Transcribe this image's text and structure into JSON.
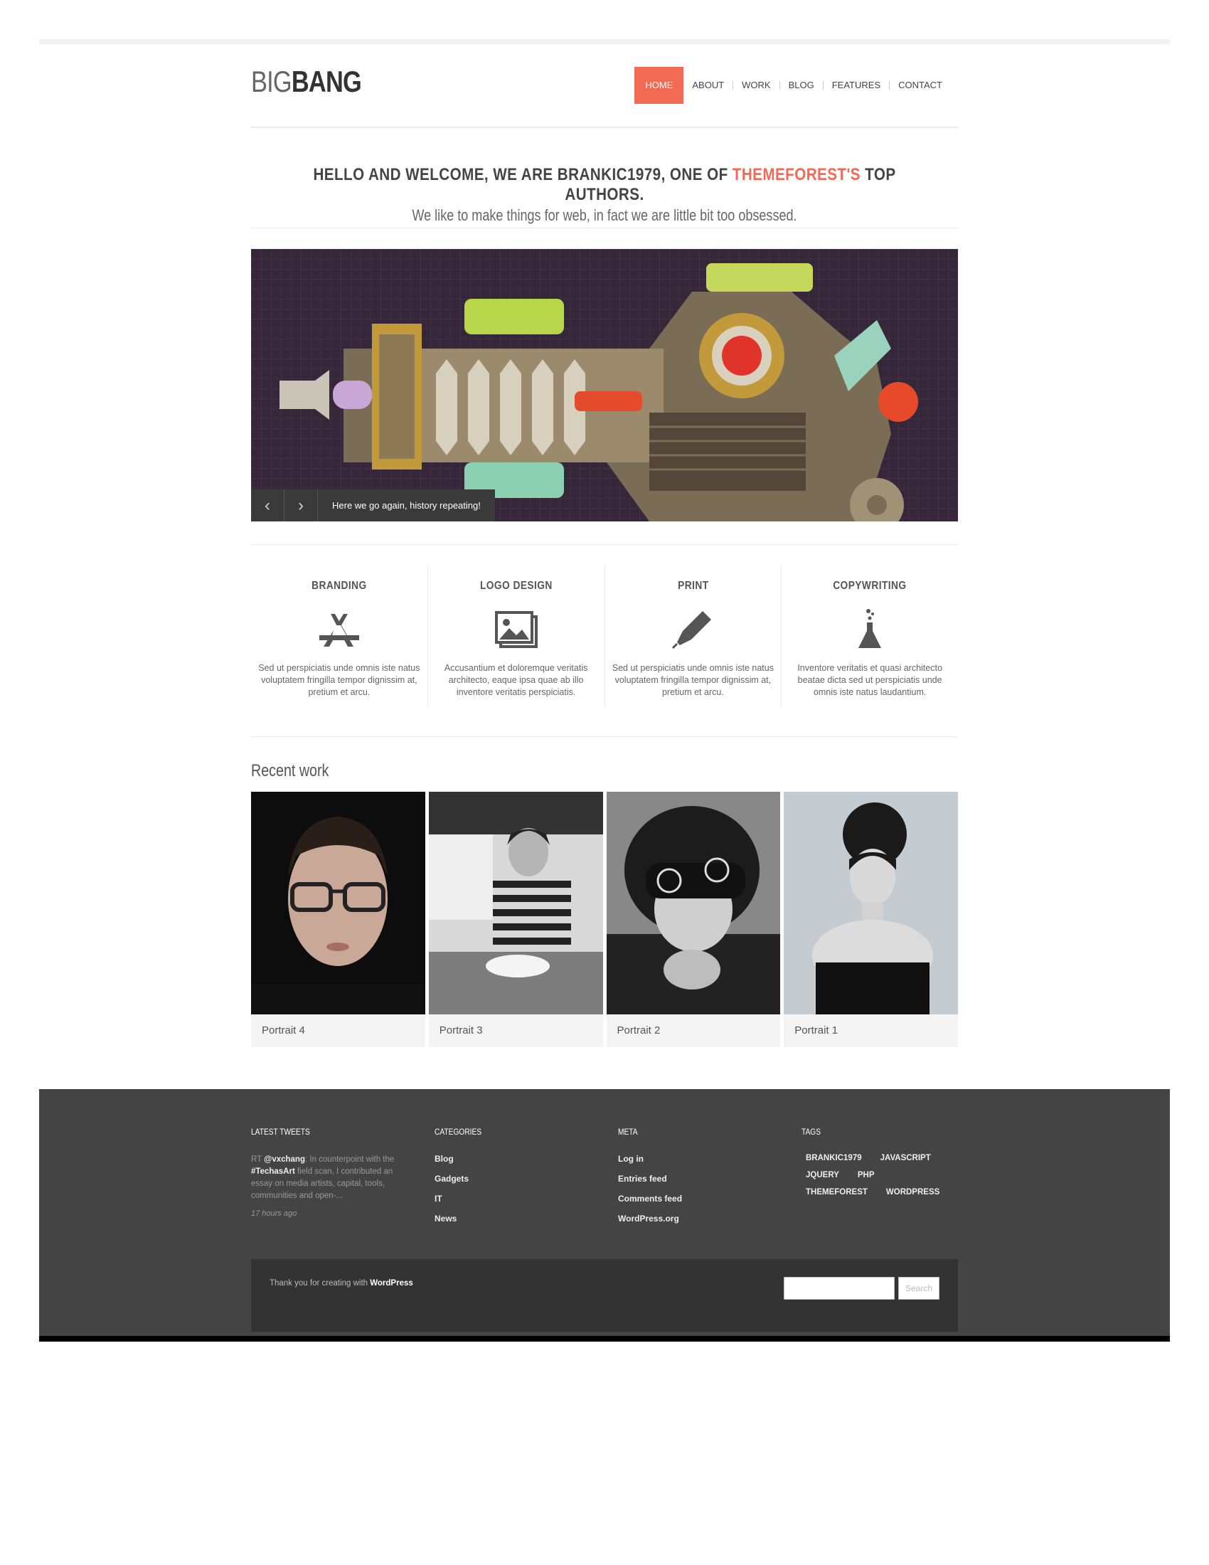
{
  "logo": {
    "thin": "BIG",
    "bold": "BANG"
  },
  "nav": [
    {
      "label": "HOME",
      "active": true
    },
    {
      "label": "ABOUT",
      "active": false
    },
    {
      "label": "WORK",
      "active": false
    },
    {
      "label": "BLOG",
      "active": false
    },
    {
      "label": "FEATURES",
      "active": false
    },
    {
      "label": "CONTACT",
      "active": false
    }
  ],
  "welcome": {
    "title_before": "HELLO AND WELCOME, WE ARE BRANKIC1979, ONE OF ",
    "title_accent": "THEMEFOREST'S",
    "title_after": " TOP AUTHORS.",
    "subtitle": "We like to make things for web, in fact we are little bit too obsessed."
  },
  "slider": {
    "prev_icon": "chevron-left-icon",
    "next_icon": "chevron-right-icon",
    "caption": "Here we go again, history repeating!"
  },
  "services": [
    {
      "title": "BRANDING",
      "icon": "app-store-icon",
      "text": "Sed ut perspiciatis unde omnis iste natus voluptatem fringilla tempor dignissim at, pretium et arcu."
    },
    {
      "title": "LOGO DESIGN",
      "icon": "image-icon",
      "text": "Accusantium et doloremque veritatis architecto, eaque ipsa quae ab illo inventore veritatis perspiciatis."
    },
    {
      "title": "PRINT",
      "icon": "pen-icon",
      "text": "Sed ut perspiciatis unde omnis iste natus voluptatem fringilla tempor dignissim at, pretium et arcu."
    },
    {
      "title": "COPYWRITING",
      "icon": "flask-icon",
      "text": "Inventore veritatis et quasi architecto beatae dicta sed ut perspiciatis unde omnis iste natus laudantium."
    }
  ],
  "recent_work": {
    "title": "Recent work",
    "items": [
      {
        "label": "Portrait 4"
      },
      {
        "label": "Portrait 3"
      },
      {
        "label": "Portrait 2"
      },
      {
        "label": "Portrait 1"
      }
    ]
  },
  "footer": {
    "tweets": {
      "heading": "LATEST TWEETS",
      "prefix": "RT ",
      "handle": "@vxchang",
      "text1": ": In counterpoint with the ",
      "hashtag": "#TechasArt",
      "text2": " field scan, I contributed an essay on media artists, capital, tools, communities and open-...",
      "time": "17 hours ago"
    },
    "categories": {
      "heading": "CATEGORIES",
      "items": [
        "Blog",
        "Gadgets",
        "IT",
        "News"
      ]
    },
    "meta": {
      "heading": "META",
      "items": [
        "Log in",
        "Entries feed",
        "Comments feed",
        "WordPress.org"
      ]
    },
    "tags": {
      "heading": "TAGS",
      "items": [
        "BRANKIC1979",
        "JAVASCRIPT",
        "JQUERY",
        "PHP",
        "THEMEFOREST",
        "WORDPRESS"
      ]
    },
    "credit_prefix": "Thank you for creating with ",
    "credit_link": "WordPress",
    "search": {
      "placeholder": "",
      "button": "Search"
    }
  },
  "colors": {
    "accent": "#f26a54",
    "footer_bg": "#444444",
    "subfooter_bg": "#333333"
  }
}
